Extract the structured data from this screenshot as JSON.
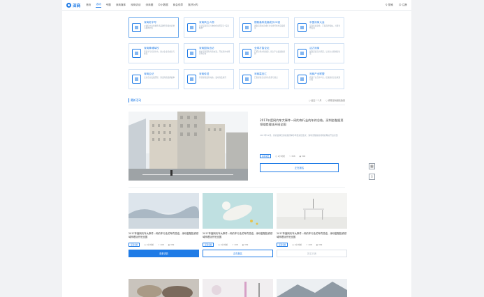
{
  "header": {
    "logo": "深商",
    "nav": [
      "首页",
      "活动",
      "专题",
      "深商媒体",
      "深商访谈",
      "深商圈",
      "中小数据",
      "商会领导",
      "找好对内"
    ],
    "active": "活动",
    "search": "搜索",
    "register": "注册"
  },
  "features": [
    {
      "title": "深商老字号",
      "desc": "以诚信立业重视传承品牌所承载的商誉与精神价值",
      "icon": "store-icon"
    },
    {
      "title": "深商风云人物",
      "desc": "记录深商风云人物的创业历程与“深商精神”",
      "icon": "person-icon"
    },
    {
      "title": "德勤高科技高成长20强",
      "desc": "德勤高科技高成长企业排行榜单深度解读",
      "icon": "award-icon"
    },
    {
      "title": "中国深商大会",
      "desc": "深商年度盛会，汇集商界领袖，共谋合作发展",
      "icon": "meeting-icon"
    },
    {
      "title": "深商黄埔军校",
      "desc": "深商学习培训平台，助力企业家成长与交流",
      "icon": "school-icon"
    },
    {
      "title": "深商国际出访",
      "desc": "组织深商国际考察交流，开拓海外市场合作平台",
      "icon": "flag-icon"
    },
    {
      "title": "全球才智论坛",
      "desc": "汇聚全球才智资源，探讨产业发展新趋势",
      "icon": "graduation-icon"
    },
    {
      "title": "活力深商",
      "desc": "展现深商活力风采，记录企业家精彩生活",
      "icon": "runner-icon"
    },
    {
      "title": "深商企记",
      "desc": "记录企业发展历程，讲述深商品牌故事",
      "icon": "notebook-icon"
    },
    {
      "title": "深商传送",
      "desc": "传递深商最新动态，发布商会资讯",
      "icon": "share-icon"
    },
    {
      "title": "深商嘉言汇",
      "desc": "汇集深商企业家的思想与观点",
      "icon": "quote-icon"
    },
    {
      "title": "深商产业联盟",
      "desc": "搭建产业合作平台，促进深商企业资源对接",
      "icon": "network-icon"
    }
  ],
  "section": {
    "title": "最新活动",
    "filters": [
      "最近一个月",
      "按照活动报名数量"
    ]
  },
  "featured": {
    "title": "2017年度网约车大事件—网约车行业的年终总结，深圳金融投资领域商理派开班全国",
    "desc": "2017年12月，新商会联合深商集团举办年度总结会议，深圳金融投资领域商理派开班全国",
    "tag": "深商总会",
    "days": "2小时前",
    "likes": "308",
    "views": "309",
    "button": "正在报名"
  },
  "cards": [
    {
      "title": "2017年度网约车大事件—网约车行业的年终总结，深圳金融投资领域商理派开班全国",
      "tag": "深商总会",
      "days": "2小时前",
      "likes": "108",
      "views": "309",
      "button": "查看详情",
      "style": "primary"
    },
    {
      "title": "2017年度网约车大事件—网约车行业的年终总结，深圳金融投资领域商理派开班全国",
      "tag": "深商总会",
      "days": "2小时前",
      "likes": "108",
      "views": "309",
      "button": "正在报名",
      "style": "outline"
    },
    {
      "title": "2017年度网约车大事件—网约车行业的年终总结，深圳金融投资领域商理派开班全国",
      "tag": "深商总会",
      "days": "2小时前",
      "likes": "108",
      "views": "309",
      "button": "报名已满",
      "style": "disabled"
    }
  ],
  "colors": {
    "accent": "#1f7be6"
  }
}
